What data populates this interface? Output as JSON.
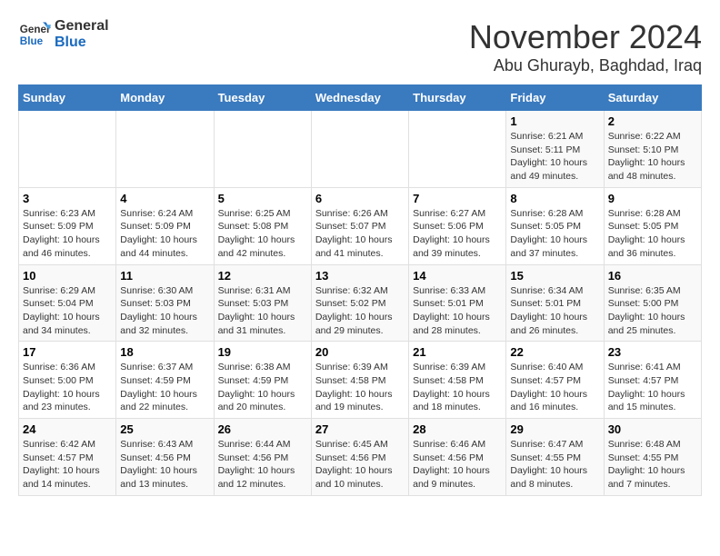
{
  "logo": {
    "line1": "General",
    "line2": "Blue"
  },
  "title": "November 2024",
  "location": "Abu Ghurayb, Baghdad, Iraq",
  "weekdays": [
    "Sunday",
    "Monday",
    "Tuesday",
    "Wednesday",
    "Thursday",
    "Friday",
    "Saturday"
  ],
  "weeks": [
    [
      {
        "day": "",
        "info": ""
      },
      {
        "day": "",
        "info": ""
      },
      {
        "day": "",
        "info": ""
      },
      {
        "day": "",
        "info": ""
      },
      {
        "day": "",
        "info": ""
      },
      {
        "day": "1",
        "info": "Sunrise: 6:21 AM\nSunset: 5:11 PM\nDaylight: 10 hours and 49 minutes."
      },
      {
        "day": "2",
        "info": "Sunrise: 6:22 AM\nSunset: 5:10 PM\nDaylight: 10 hours and 48 minutes."
      }
    ],
    [
      {
        "day": "3",
        "info": "Sunrise: 6:23 AM\nSunset: 5:09 PM\nDaylight: 10 hours and 46 minutes."
      },
      {
        "day": "4",
        "info": "Sunrise: 6:24 AM\nSunset: 5:09 PM\nDaylight: 10 hours and 44 minutes."
      },
      {
        "day": "5",
        "info": "Sunrise: 6:25 AM\nSunset: 5:08 PM\nDaylight: 10 hours and 42 minutes."
      },
      {
        "day": "6",
        "info": "Sunrise: 6:26 AM\nSunset: 5:07 PM\nDaylight: 10 hours and 41 minutes."
      },
      {
        "day": "7",
        "info": "Sunrise: 6:27 AM\nSunset: 5:06 PM\nDaylight: 10 hours and 39 minutes."
      },
      {
        "day": "8",
        "info": "Sunrise: 6:28 AM\nSunset: 5:05 PM\nDaylight: 10 hours and 37 minutes."
      },
      {
        "day": "9",
        "info": "Sunrise: 6:28 AM\nSunset: 5:05 PM\nDaylight: 10 hours and 36 minutes."
      }
    ],
    [
      {
        "day": "10",
        "info": "Sunrise: 6:29 AM\nSunset: 5:04 PM\nDaylight: 10 hours and 34 minutes."
      },
      {
        "day": "11",
        "info": "Sunrise: 6:30 AM\nSunset: 5:03 PM\nDaylight: 10 hours and 32 minutes."
      },
      {
        "day": "12",
        "info": "Sunrise: 6:31 AM\nSunset: 5:03 PM\nDaylight: 10 hours and 31 minutes."
      },
      {
        "day": "13",
        "info": "Sunrise: 6:32 AM\nSunset: 5:02 PM\nDaylight: 10 hours and 29 minutes."
      },
      {
        "day": "14",
        "info": "Sunrise: 6:33 AM\nSunset: 5:01 PM\nDaylight: 10 hours and 28 minutes."
      },
      {
        "day": "15",
        "info": "Sunrise: 6:34 AM\nSunset: 5:01 PM\nDaylight: 10 hours and 26 minutes."
      },
      {
        "day": "16",
        "info": "Sunrise: 6:35 AM\nSunset: 5:00 PM\nDaylight: 10 hours and 25 minutes."
      }
    ],
    [
      {
        "day": "17",
        "info": "Sunrise: 6:36 AM\nSunset: 5:00 PM\nDaylight: 10 hours and 23 minutes."
      },
      {
        "day": "18",
        "info": "Sunrise: 6:37 AM\nSunset: 4:59 PM\nDaylight: 10 hours and 22 minutes."
      },
      {
        "day": "19",
        "info": "Sunrise: 6:38 AM\nSunset: 4:59 PM\nDaylight: 10 hours and 20 minutes."
      },
      {
        "day": "20",
        "info": "Sunrise: 6:39 AM\nSunset: 4:58 PM\nDaylight: 10 hours and 19 minutes."
      },
      {
        "day": "21",
        "info": "Sunrise: 6:39 AM\nSunset: 4:58 PM\nDaylight: 10 hours and 18 minutes."
      },
      {
        "day": "22",
        "info": "Sunrise: 6:40 AM\nSunset: 4:57 PM\nDaylight: 10 hours and 16 minutes."
      },
      {
        "day": "23",
        "info": "Sunrise: 6:41 AM\nSunset: 4:57 PM\nDaylight: 10 hours and 15 minutes."
      }
    ],
    [
      {
        "day": "24",
        "info": "Sunrise: 6:42 AM\nSunset: 4:57 PM\nDaylight: 10 hours and 14 minutes."
      },
      {
        "day": "25",
        "info": "Sunrise: 6:43 AM\nSunset: 4:56 PM\nDaylight: 10 hours and 13 minutes."
      },
      {
        "day": "26",
        "info": "Sunrise: 6:44 AM\nSunset: 4:56 PM\nDaylight: 10 hours and 12 minutes."
      },
      {
        "day": "27",
        "info": "Sunrise: 6:45 AM\nSunset: 4:56 PM\nDaylight: 10 hours and 10 minutes."
      },
      {
        "day": "28",
        "info": "Sunrise: 6:46 AM\nSunset: 4:56 PM\nDaylight: 10 hours and 9 minutes."
      },
      {
        "day": "29",
        "info": "Sunrise: 6:47 AM\nSunset: 4:55 PM\nDaylight: 10 hours and 8 minutes."
      },
      {
        "day": "30",
        "info": "Sunrise: 6:48 AM\nSunset: 4:55 PM\nDaylight: 10 hours and 7 minutes."
      }
    ]
  ]
}
